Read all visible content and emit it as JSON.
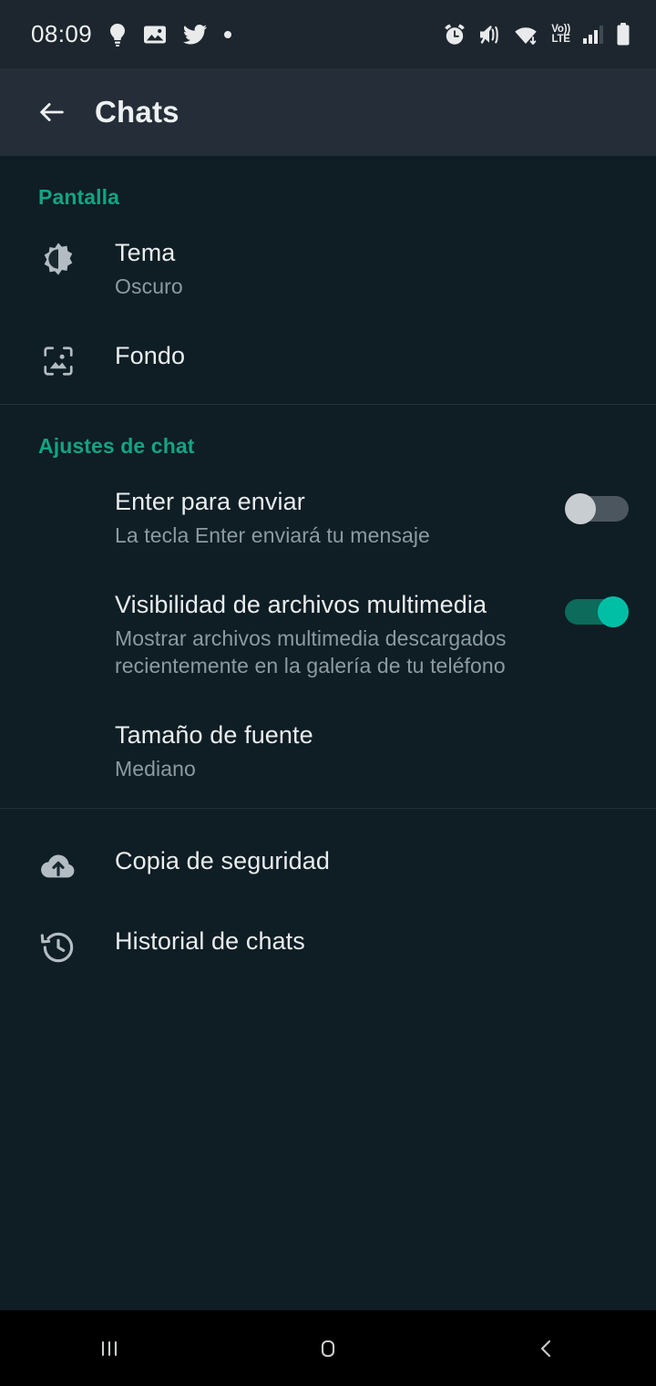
{
  "status_bar": {
    "time": "08:09",
    "left_icons": [
      "lightbulb-icon",
      "gallery-icon",
      "twitter-icon",
      "dot-icon"
    ],
    "right_icons": [
      "alarm-icon",
      "mute-vibrate-icon",
      "wifi-icon",
      "volte-icon",
      "signal-icon",
      "battery-icon"
    ],
    "volte_top": "Vo))",
    "volte_bottom": "LTE"
  },
  "app_bar": {
    "back_icon": "back-arrow-icon",
    "title": "Chats"
  },
  "colors": {
    "accent_teal": "#14a383",
    "toggle_on": "#00bfa5",
    "background": "#0f1d24",
    "appbar_background": "#252e38",
    "primary_text": "#e9edef",
    "secondary_text": "#8d9ba1"
  },
  "sections": [
    {
      "title": "Pantalla",
      "rows": [
        {
          "icon": "brightness-theme-icon",
          "title": "Tema",
          "subtitle": "Oscuro"
        },
        {
          "icon": "wallpaper-icon",
          "title": "Fondo",
          "subtitle": ""
        }
      ]
    },
    {
      "title": "Ajustes de chat",
      "rows": [
        {
          "icon": "",
          "title": "Enter para enviar",
          "subtitle": "La tecla Enter enviará tu mensaje",
          "toggle": "off"
        },
        {
          "icon": "",
          "title": "Visibilidad de archivos multimedia",
          "subtitle": "Mostrar archivos multimedia descargados recientemente en la galería de tu teléfono",
          "toggle": "on"
        },
        {
          "icon": "",
          "title": "Tamaño de fuente",
          "subtitle": "Mediano"
        }
      ]
    },
    {
      "title": "",
      "rows": [
        {
          "icon": "cloud-upload-icon",
          "title": "Copia de seguridad",
          "subtitle": ""
        },
        {
          "icon": "history-icon",
          "title": "Historial de chats",
          "subtitle": ""
        }
      ]
    }
  ],
  "nav_bar": {
    "recents_label": "recents-icon",
    "home_label": "home-icon",
    "back_label": "back-icon"
  }
}
